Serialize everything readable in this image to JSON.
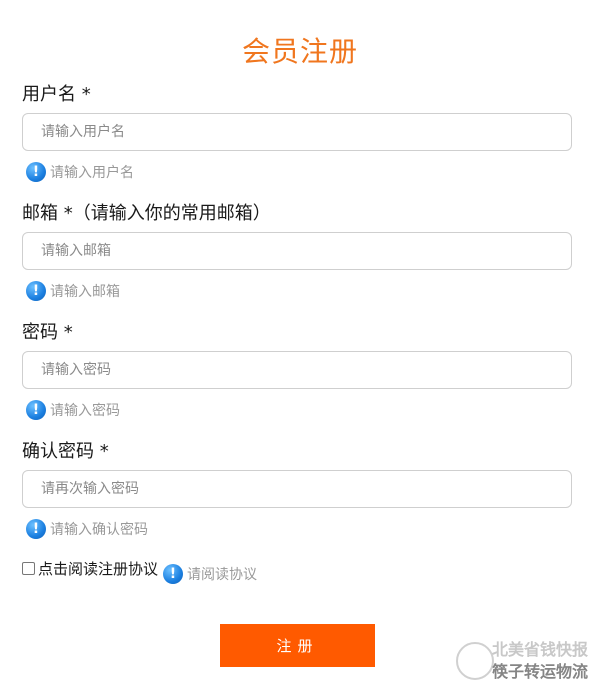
{
  "form": {
    "title": "会员注册",
    "fields": [
      {
        "label": "用户名 *",
        "placeholder": "请输入用户名",
        "hint": "请输入用户名"
      },
      {
        "label": "邮箱 *（请输入你的常用邮箱）",
        "placeholder": "请输入邮箱",
        "hint": "请输入邮箱"
      },
      {
        "label": "密码 *",
        "placeholder": "请输入密码",
        "hint": "请输入密码"
      },
      {
        "label": "确认密码 *",
        "placeholder": "请再次输入密码",
        "hint": "请输入确认密码"
      }
    ],
    "agreement": {
      "label": "点击阅读注册协议",
      "hint": "请阅读协议",
      "checked": false
    },
    "submit_label": "注册"
  },
  "watermark": {
    "line1": "北美省钱快报",
    "line2": "筷子转运物流"
  },
  "icons": {
    "hint_icon": "info-icon",
    "hint_icon_glyph": "!"
  },
  "colors": {
    "title": "#f0761e",
    "button": "#ff5a00",
    "hint_icon": "#1b7fe0"
  }
}
